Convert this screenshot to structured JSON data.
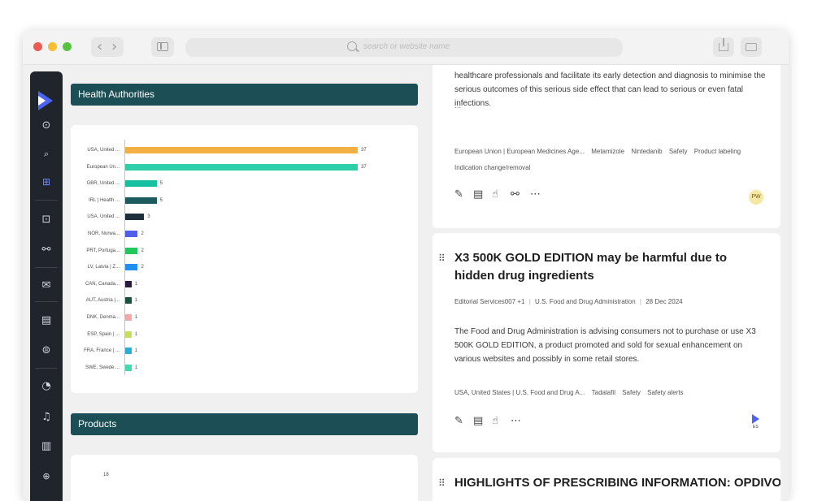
{
  "browser": {
    "url_placeholder": "search or website name",
    "traffic_colors": [
      "#ee5b52",
      "#f5bf2f",
      "#56c440"
    ]
  },
  "sidebar": {
    "icons": [
      "logo-icon",
      "forward-icon",
      "search-icon",
      "grid-icon",
      "inbox-icon",
      "molecule-icon",
      "mail-icon",
      "document-icon",
      "jar-icon",
      "speed-icon",
      "bell-icon",
      "file-icon",
      "zoom-icon"
    ]
  },
  "health_authorities": {
    "title": "Health Authorities",
    "chart_data": {
      "type": "bar",
      "orientation": "horizontal",
      "categories": [
        "USA, United ...",
        "European Un...",
        "GBR, United ...",
        "IRL | Health ...",
        "USA, United ...",
        "NOR, Norwa...",
        "PRT, Portuga...",
        "LV, Latvia | Z...",
        "CAN, Canada...",
        "AUT, Austria |...",
        "DNK, Denma...",
        "ESP, Spain | ...",
        "FRA, France | ...",
        "SWE, Swede ..."
      ],
      "values": [
        37,
        37,
        5,
        5,
        3,
        2,
        2,
        2,
        1,
        1,
        1,
        1,
        1,
        1
      ],
      "colors": [
        "#f2b042",
        "#2ecfa8",
        "#17bfa1",
        "#1b5b5e",
        "#1f2e3b",
        "#5060e6",
        "#24c75b",
        "#1f8ff0",
        "#2a1b3d",
        "#17523d",
        "#f4a7a7",
        "#c4e05c",
        "#2aacd9",
        "#41d9b0"
      ],
      "xlim": [
        0,
        37
      ]
    }
  },
  "products": {
    "title": "Products",
    "first_tick": "18"
  },
  "cards": [
    {
      "body": "healthcare professionals and facilitate its early detection and diagnosis to minimise the serious outcomes of this serious side effect that can lead to serious or even fatal infections.",
      "ellipsis": "...",
      "tags_line1": [
        "European Union | European Medicines Age...",
        "Metamizole",
        "Nintedanib",
        "Safety",
        "Product labeling"
      ],
      "tags_line2": [
        "Indication change/removal"
      ],
      "avatar": "PW"
    },
    {
      "title": "X3 500K GOLD EDITION may be harmful due to hidden drug ingredients",
      "author": "Editorial Services007 +1",
      "source": "U.S. Food and Drug Administration",
      "date": "28 Dec 2024",
      "body": "The Food and Drug Administration is advising consumers not to purchase or use X3 500K GOLD EDITION, a product promoted and sold for sexual enhancement on various websites and possibly in some retail stores.",
      "tags": [
        "USA, United States | U.S. Food and Drug A...",
        "Tadalafil",
        "Safety",
        "Safety alerts"
      ],
      "badge": "ES"
    },
    {
      "title": "HIGHLIGHTS OF PRESCRIBING INFORMATION: OPDIVO QVANTIG"
    }
  ]
}
